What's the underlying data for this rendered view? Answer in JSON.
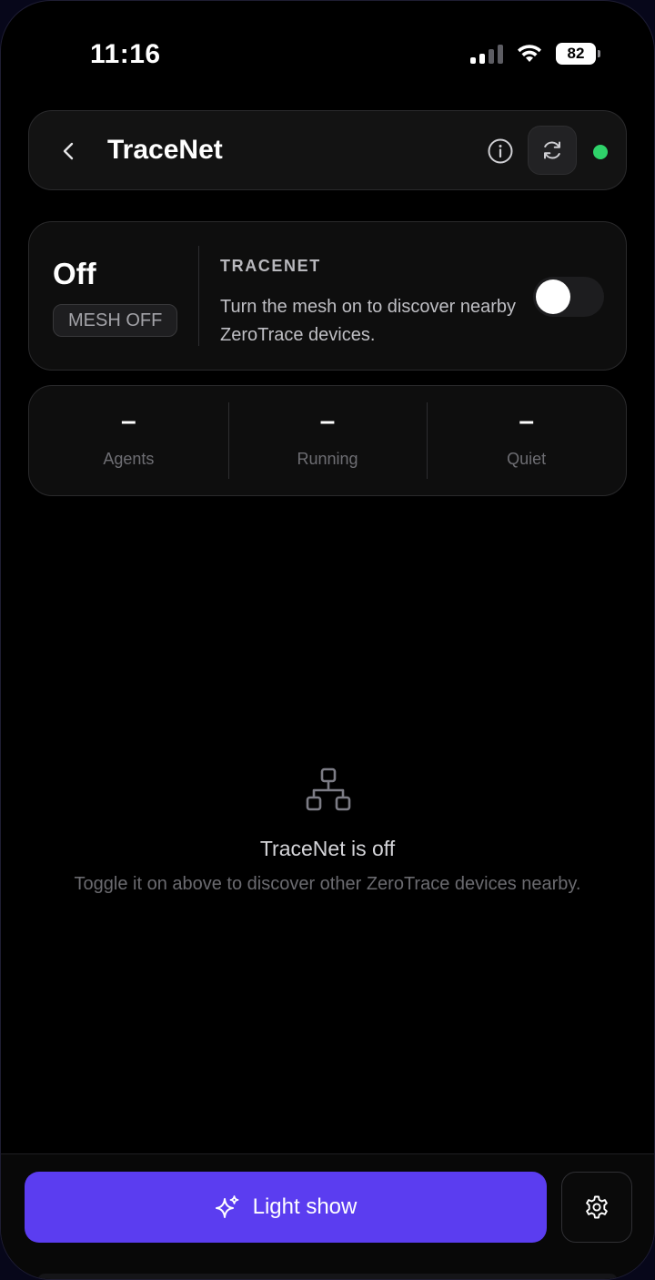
{
  "status_bar": {
    "time": "11:16",
    "battery": "82"
  },
  "header": {
    "title": "TraceNet",
    "status_color": "#2fd36a"
  },
  "mesh": {
    "state": "Off",
    "badge": "MESH OFF",
    "label": "TRACENET",
    "description": "Turn the mesh on to discover nearby ZeroTrace devices.",
    "toggle_on": false
  },
  "stats": [
    {
      "value": "–",
      "label": "Agents"
    },
    {
      "value": "–",
      "label": "Running"
    },
    {
      "value": "–",
      "label": "Quiet"
    }
  ],
  "empty_state": {
    "title": "TraceNet is off",
    "subtitle": "Toggle it on above to discover other ZeroTrace devices nearby."
  },
  "bottom": {
    "primary_label": "Light show",
    "accent_color": "#5b3df0"
  }
}
